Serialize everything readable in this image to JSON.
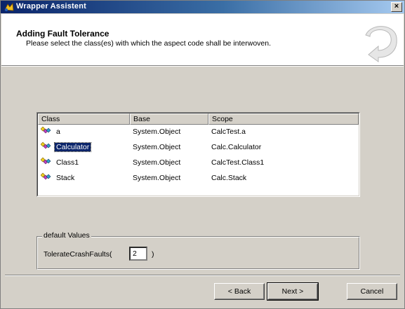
{
  "window": {
    "title": "Wrapper Assistent",
    "close_label": "×",
    "colors": {
      "titlebar_start": "#0a246a",
      "titlebar_end": "#a6caf0",
      "face": "#d4d0c8",
      "selection": "#0a246a"
    }
  },
  "header": {
    "heading": "Adding Fault Tolerance",
    "subheading": "Please select the class(es) with which the aspect code shall be interwoven.",
    "wizard_icon": "wizard-arrow-icon"
  },
  "classes_table": {
    "columns": [
      "Class",
      "Base",
      "Scope"
    ],
    "rows": [
      {
        "class": "a",
        "base": "System.Object",
        "scope": "CalcTest.a",
        "selected": false,
        "icon": "class-icon"
      },
      {
        "class": "Calculator",
        "base": "System.Object",
        "scope": "Calc.Calculator",
        "selected": true,
        "icon": "class-icon"
      },
      {
        "class": "Class1",
        "base": "System.Object",
        "scope": "CalcTest.Class1",
        "selected": false,
        "icon": "class-icon"
      },
      {
        "class": "Stack",
        "base": "System.Object",
        "scope": "Calc.Stack",
        "selected": false,
        "icon": "class-icon"
      }
    ]
  },
  "default_values": {
    "legend": "default Values",
    "tolerate_label": "TolerateCrashFaults(",
    "tolerate_value": "2",
    "tolerate_suffix": ")"
  },
  "buttons": {
    "back": "< Back",
    "next": "Next >",
    "cancel": "Cancel"
  }
}
